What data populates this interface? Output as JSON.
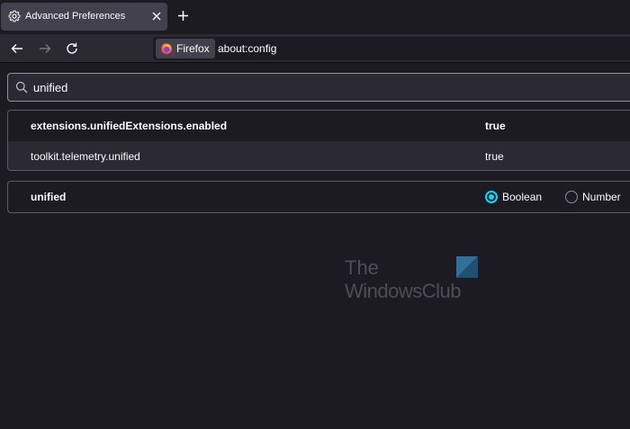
{
  "tab": {
    "title": "Advanced Preferences",
    "icon": "gear-icon"
  },
  "nav": {
    "identity_label": "Firefox",
    "url": "about:config"
  },
  "search": {
    "value": "unified"
  },
  "prefs": [
    {
      "name": "extensions.unifiedExtensions.enabled",
      "value": "true",
      "modified": true
    },
    {
      "name": "toolkit.telemetry.unified",
      "value": "true",
      "modified": false
    }
  ],
  "add_pref": {
    "name": "unified",
    "type_options": [
      "Boolean",
      "Number"
    ],
    "selected_type": "Boolean"
  },
  "watermark": {
    "line1": "The",
    "line2": "WindowsClub"
  },
  "colors": {
    "background": "#1c1b22",
    "toolbar": "#2b2a33",
    "accent": "#00ddff"
  }
}
